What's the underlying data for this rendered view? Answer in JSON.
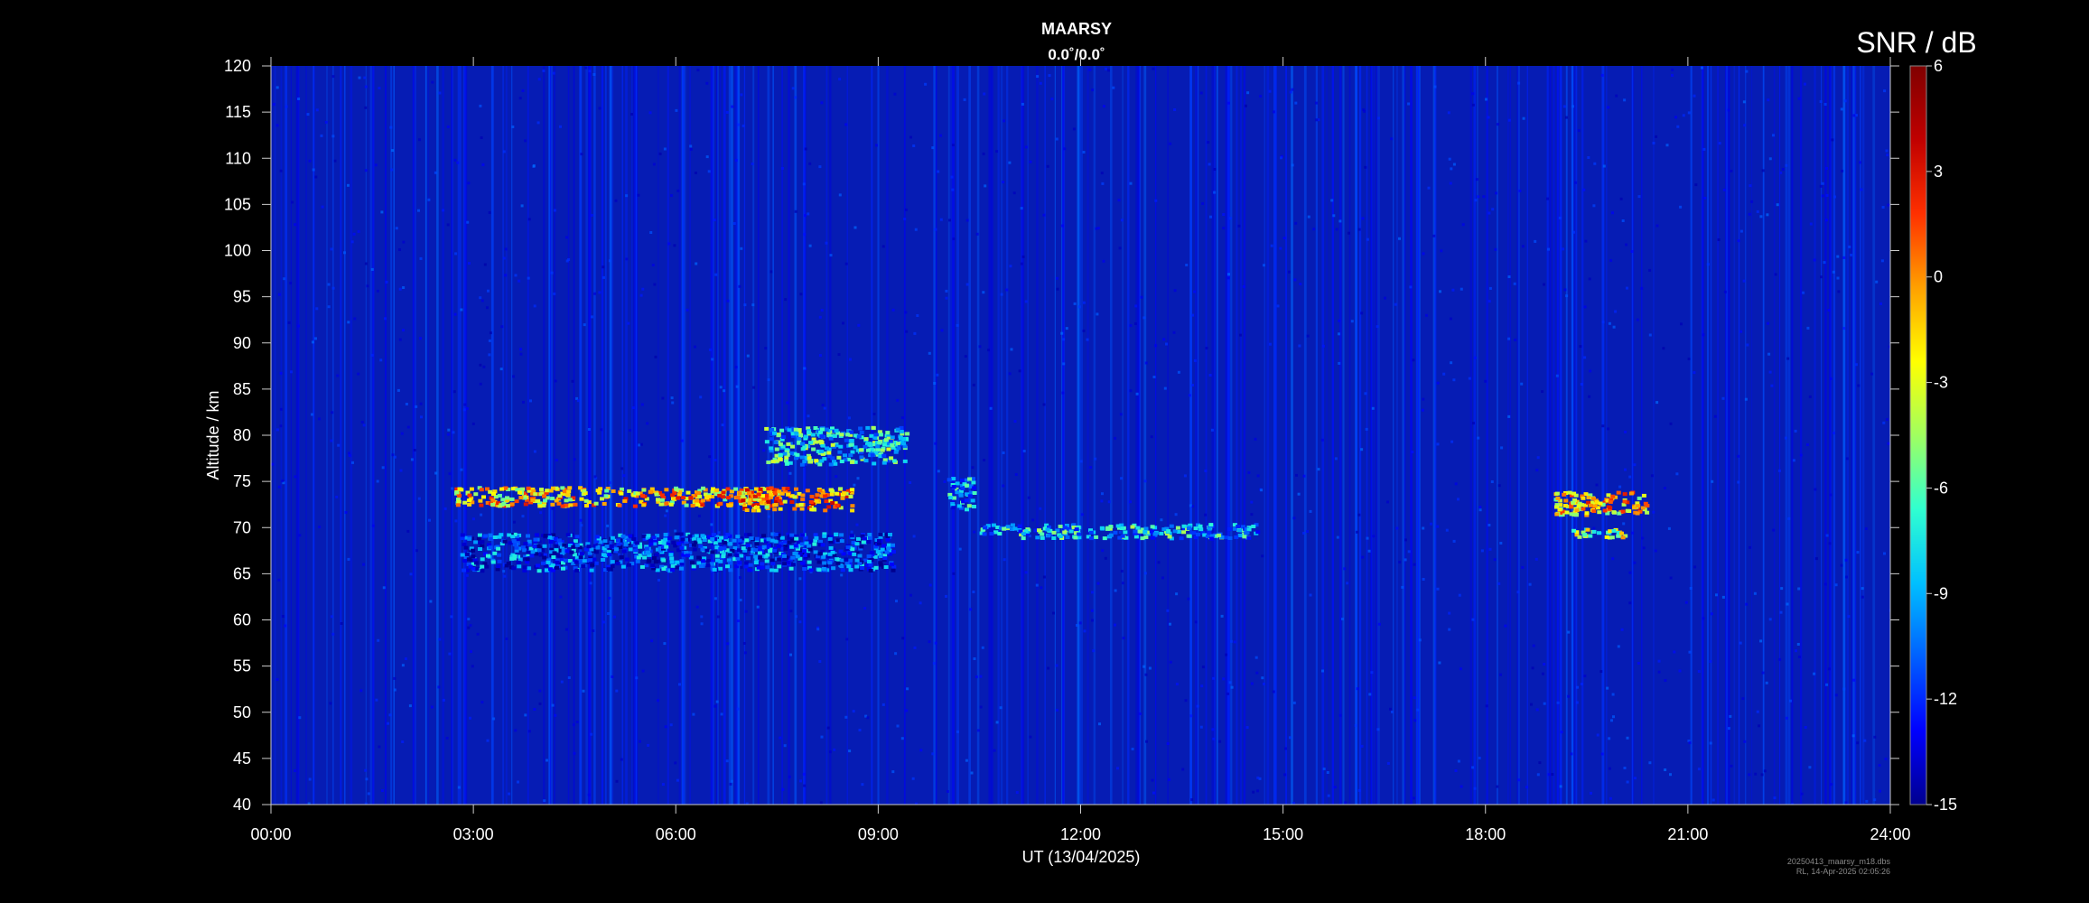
{
  "chart_data": {
    "type": "heatmap",
    "title": "MAARSY",
    "subtitle": "0.0˚/0.0˚",
    "xlabel": "UT (13/04/2025)",
    "ylabel": "Altitude / km",
    "x_ticks": [
      "00:00",
      "03:00",
      "06:00",
      "09:00",
      "12:00",
      "15:00",
      "18:00",
      "21:00",
      "24:00"
    ],
    "x_range_hours": [
      0,
      24
    ],
    "y_ticks": [
      40,
      45,
      50,
      55,
      60,
      65,
      70,
      75,
      80,
      85,
      90,
      95,
      100,
      105,
      110,
      115,
      120
    ],
    "y_range_km": [
      40,
      120
    ],
    "colorbar": {
      "title": "SNR / dB",
      "range": [
        -15,
        6
      ],
      "ticks": [
        6,
        3,
        0,
        -3,
        -6,
        -9,
        -12,
        -15
      ],
      "colors": [
        "#00008f",
        "#0000ff",
        "#0060ff",
        "#00c0ff",
        "#30ffd0",
        "#a0ff60",
        "#ffff00",
        "#ffa000",
        "#ff3000",
        "#c00000",
        "#800000"
      ]
    },
    "background_snr_db": -13.5,
    "echo_regions": [
      {
        "t_start": 2.7,
        "t_end": 7.4,
        "alt_start": 72.5,
        "alt_end": 74.5,
        "snr_db": 3
      },
      {
        "t_start": 6.9,
        "t_end": 8.6,
        "alt_start": 72,
        "alt_end": 74.5,
        "snr_db": 4
      },
      {
        "t_start": 2.8,
        "t_end": 9.2,
        "alt_start": 65.5,
        "alt_end": 69.5,
        "snr_db": -7
      },
      {
        "t_start": 7.3,
        "t_end": 9.4,
        "alt_start": 77,
        "alt_end": 81,
        "snr_db": -3
      },
      {
        "t_start": 10.5,
        "t_end": 14.6,
        "alt_start": 69,
        "alt_end": 70.5,
        "snr_db": -4
      },
      {
        "t_start": 10.0,
        "t_end": 10.4,
        "alt_start": 72,
        "alt_end": 75.5,
        "snr_db": -5
      },
      {
        "t_start": 19.0,
        "t_end": 20.4,
        "alt_start": 71.5,
        "alt_end": 74,
        "snr_db": 3
      },
      {
        "t_start": 19.2,
        "t_end": 20.1,
        "alt_start": 69,
        "alt_end": 70,
        "snr_db": 0
      }
    ]
  },
  "footer": {
    "file_name": "20250413_maarsy_m18.dbs",
    "created": "RL, 14-Apr-2025 02:05:26"
  }
}
